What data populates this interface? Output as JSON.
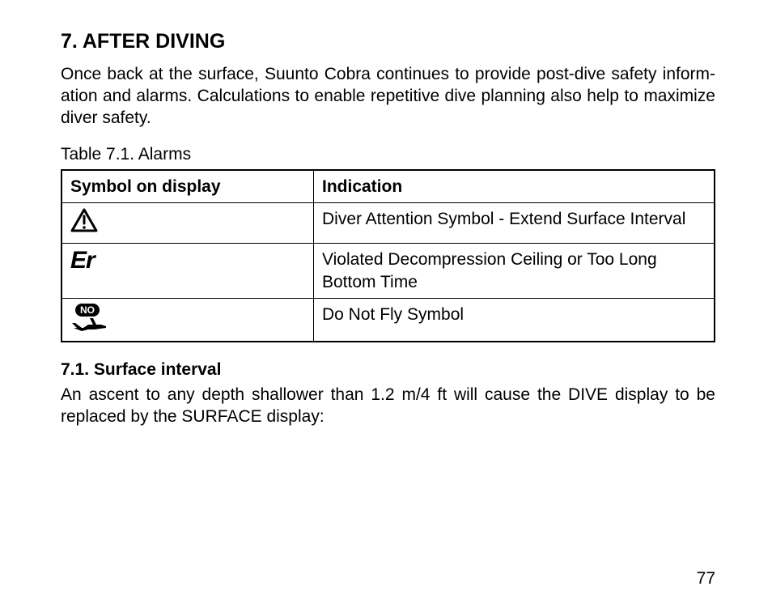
{
  "section": {
    "number": "7.",
    "title": "AFTER DIVING",
    "heading": "7.  AFTER DIVING"
  },
  "intro": "Once back at the surface, Suunto Cobra continues to provide post-dive safety inform- ation and alarms. Calculations to enable repetitive dive planning also help to maximize diver safety.",
  "table": {
    "caption": "Table 7.1. Alarms",
    "headers": {
      "symbol": "Symbol on display",
      "indication": "Indication"
    },
    "rows": [
      {
        "icon": "warning-triangle-icon",
        "indication": "Diver Attention Symbol - Extend Surface Interval"
      },
      {
        "icon": "er-icon",
        "er_text": "Er",
        "indication": "Violated Decompression Ceiling or Too Long Bottom Time"
      },
      {
        "icon": "no-fly-icon",
        "no_label": "NO",
        "indication": "Do Not Fly Symbol"
      }
    ]
  },
  "subsection": {
    "heading": "7.1. Surface interval",
    "body": "An ascent to any depth shallower than 1.2 m/4 ft will cause the DIVE display to be replaced by the SURFACE display:"
  },
  "page_number": "77"
}
